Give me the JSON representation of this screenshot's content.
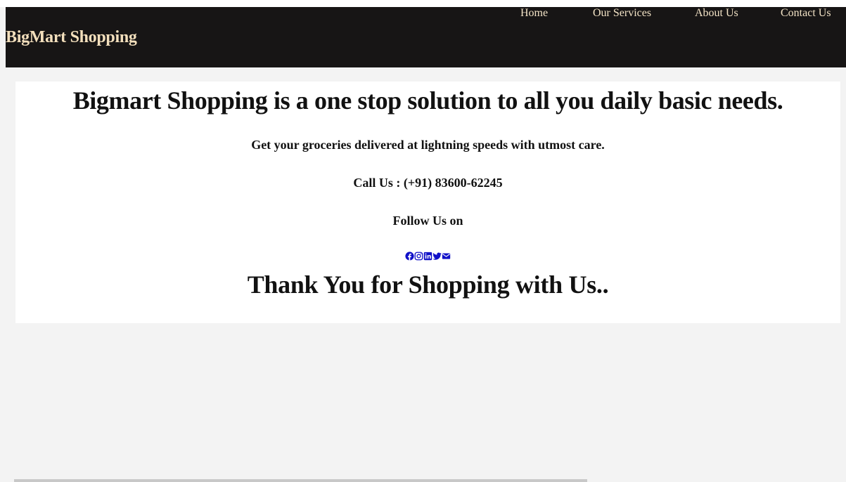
{
  "navbar": {
    "brand": "BigMart Shopping",
    "links": [
      {
        "label": "Home"
      },
      {
        "label": "Our Services"
      },
      {
        "label": "About Us"
      },
      {
        "label": "Contact Us"
      }
    ]
  },
  "main": {
    "headline": "Bigmart Shopping is a one stop solution to all you daily basic needs.",
    "tagline": "Get your groceries delivered at lightning speeds with utmost care.",
    "phone": "Call Us : (+91) 83600-62245",
    "follow": "Follow Us on",
    "social_icons": [
      "facebook-icon",
      "instagram-icon",
      "linkedin-icon",
      "twitter-icon",
      "envelope-icon"
    ],
    "thanks": "Thank You for Shopping with Us.."
  },
  "colors": {
    "navbar_bg": "#171515",
    "brand_text": "#f3dfbc",
    "icon_blue": "#1010c8",
    "page_bg": "#f3f3f3"
  }
}
